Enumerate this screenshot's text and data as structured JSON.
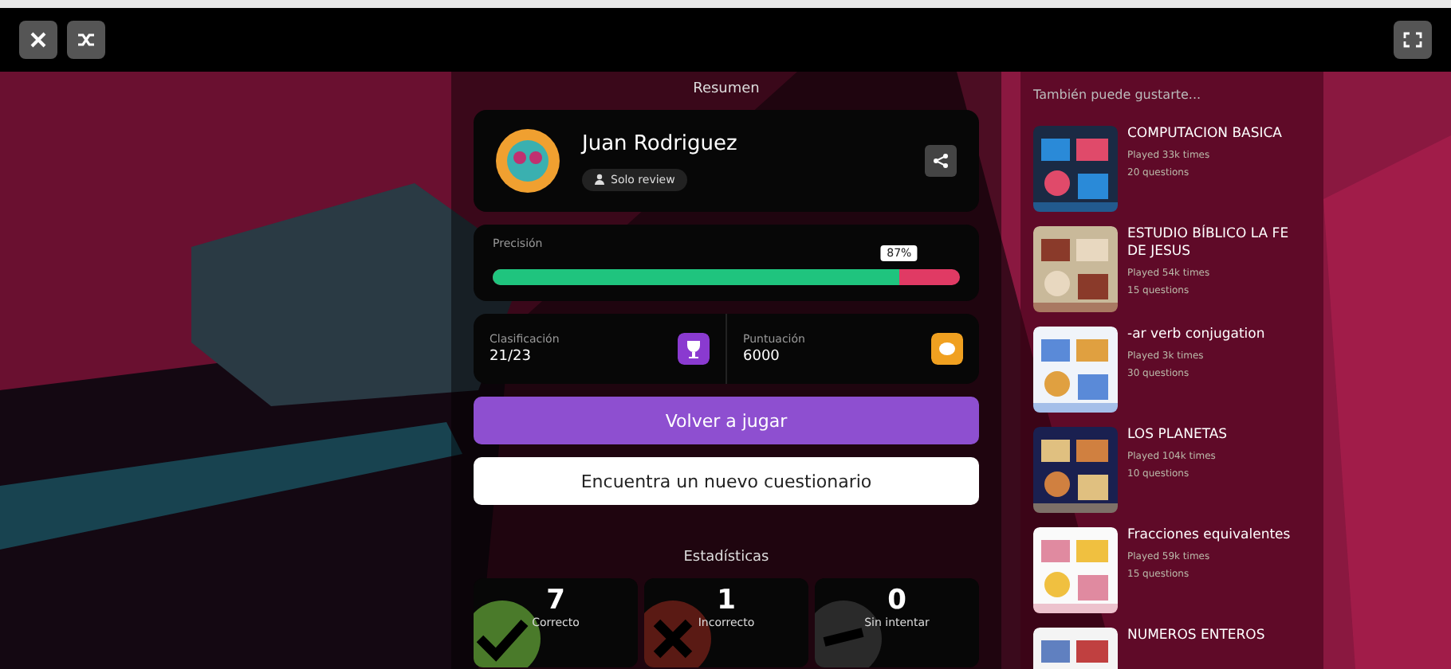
{
  "toolbar": {
    "buttons": [
      {
        "kind": "close"
      },
      {
        "kind": "shuffle"
      }
    ],
    "right_buttons": [
      {
        "kind": "fullscreen"
      }
    ]
  },
  "summary": {
    "title": "Resumen",
    "player": {
      "name": "Juan Rodriguez",
      "mode": "Solo review"
    },
    "accuracy": {
      "label": "Precisión",
      "level": 0.87,
      "reading": "87%"
    },
    "rank": {
      "label": "Clasificación",
      "value": "21/23"
    },
    "score": {
      "label": "Puntuación",
      "value": "6000"
    },
    "play_again": "Volver a jugar",
    "find_new": "Encuentra un nuevo cuestionario",
    "stats_title": "Estadísticas",
    "stats": [
      {
        "kind": "correct",
        "value": "7",
        "label": "Correcto"
      },
      {
        "kind": "incorrect",
        "value": "1",
        "label": "Incorrecto"
      },
      {
        "kind": "skipped",
        "value": "0",
        "label": "Sin intentar"
      }
    ]
  },
  "recommendations": {
    "title": "También puede gustarte...",
    "items": [
      {
        "title": "COMPUTACION BASICA",
        "plays": "Played 33k times",
        "questions": "20 questions"
      },
      {
        "title": "ESTUDIO BÍBLICO LA FE DE JESUS",
        "plays": "Played 54k times",
        "questions": "15 questions"
      },
      {
        "title": "-ar verb conjugation",
        "plays": "Played 3k times",
        "questions": "30 questions"
      },
      {
        "title": "LOS PLANETAS",
        "plays": "Played 104k times",
        "questions": "10 questions"
      },
      {
        "title": "Fracciones equivalentes",
        "plays": "Played 59k times",
        "questions": "15 questions"
      },
      {
        "title": "NUMEROS ENTEROS"
      }
    ]
  }
}
